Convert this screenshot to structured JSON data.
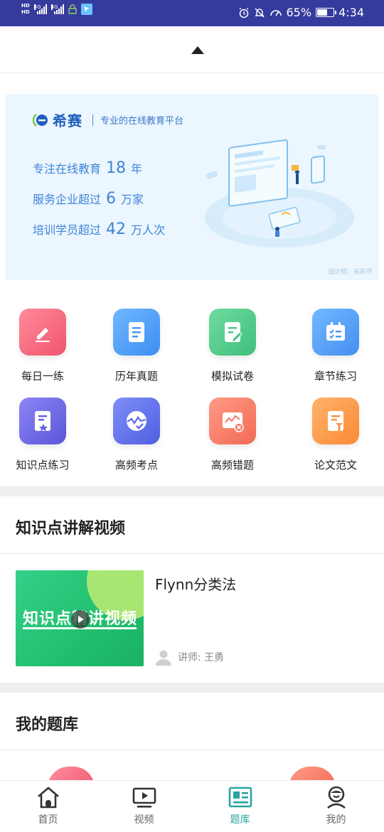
{
  "status_bar": {
    "hd_label": "HD",
    "network_1": "4G",
    "network_2": "4G",
    "battery_text": "65%",
    "battery_level": 0.65,
    "time": "4:34"
  },
  "banner": {
    "brand_name": "希赛",
    "tagline": "专业的在线教育平台",
    "lines": [
      {
        "prefix": "专注在线教育",
        "number": "18",
        "suffix": "年"
      },
      {
        "prefix": "服务企业超过",
        "number": "6",
        "suffix": "万家"
      },
      {
        "prefix": "培训学员超过",
        "number": "42",
        "suffix": "万人次"
      }
    ],
    "designer_credit": "设计师：宋彩平"
  },
  "grid": {
    "items": [
      {
        "label": "每日一练",
        "icon": "pencil-icon",
        "color_from": "#ff8a9a",
        "color_to": "#f0566d"
      },
      {
        "label": "历年真题",
        "icon": "document-icon",
        "color_from": "#6fb7ff",
        "color_to": "#3e8ef3"
      },
      {
        "label": "模拟试卷",
        "icon": "edit-paper-icon",
        "color_from": "#6fdba0",
        "color_to": "#3fbf7a"
      },
      {
        "label": "章节练习",
        "icon": "checklist-icon",
        "color_from": "#72b8ff",
        "color_to": "#468ef0"
      },
      {
        "label": "知识点练习",
        "icon": "bookmark-paper-icon",
        "color_from": "#8b86f5",
        "color_to": "#5a55d8"
      },
      {
        "label": "高频考点",
        "icon": "wave-check-icon",
        "color_from": "#7f8ef8",
        "color_to": "#4f5fe0"
      },
      {
        "label": "高频错题",
        "icon": "error-chart-icon",
        "color_from": "#ff9a86",
        "color_to": "#f26a55"
      },
      {
        "label": "论文范文",
        "icon": "paper-pen-icon",
        "color_from": "#ffb36b",
        "color_to": "#fa8a35"
      }
    ]
  },
  "video_section": {
    "title": "知识点讲解视频",
    "video": {
      "thumbnail_text": "知识点精讲视频",
      "title": "Flynn分类法",
      "teacher": "讲师: 王勇"
    }
  },
  "bank_section": {
    "title": "我的题库"
  },
  "tabbar": {
    "tabs": [
      {
        "label": "首页",
        "icon": "home-icon"
      },
      {
        "label": "视频",
        "icon": "video-icon"
      },
      {
        "label": "题库",
        "icon": "question-bank-icon",
        "active": true
      },
      {
        "label": "我的",
        "icon": "profile-icon"
      }
    ]
  },
  "colors": {
    "status_bar": "#353b9c",
    "accent": "#2aa3a3",
    "banner_bg": "#ebf6fe",
    "banner_text": "#3d84d8"
  }
}
